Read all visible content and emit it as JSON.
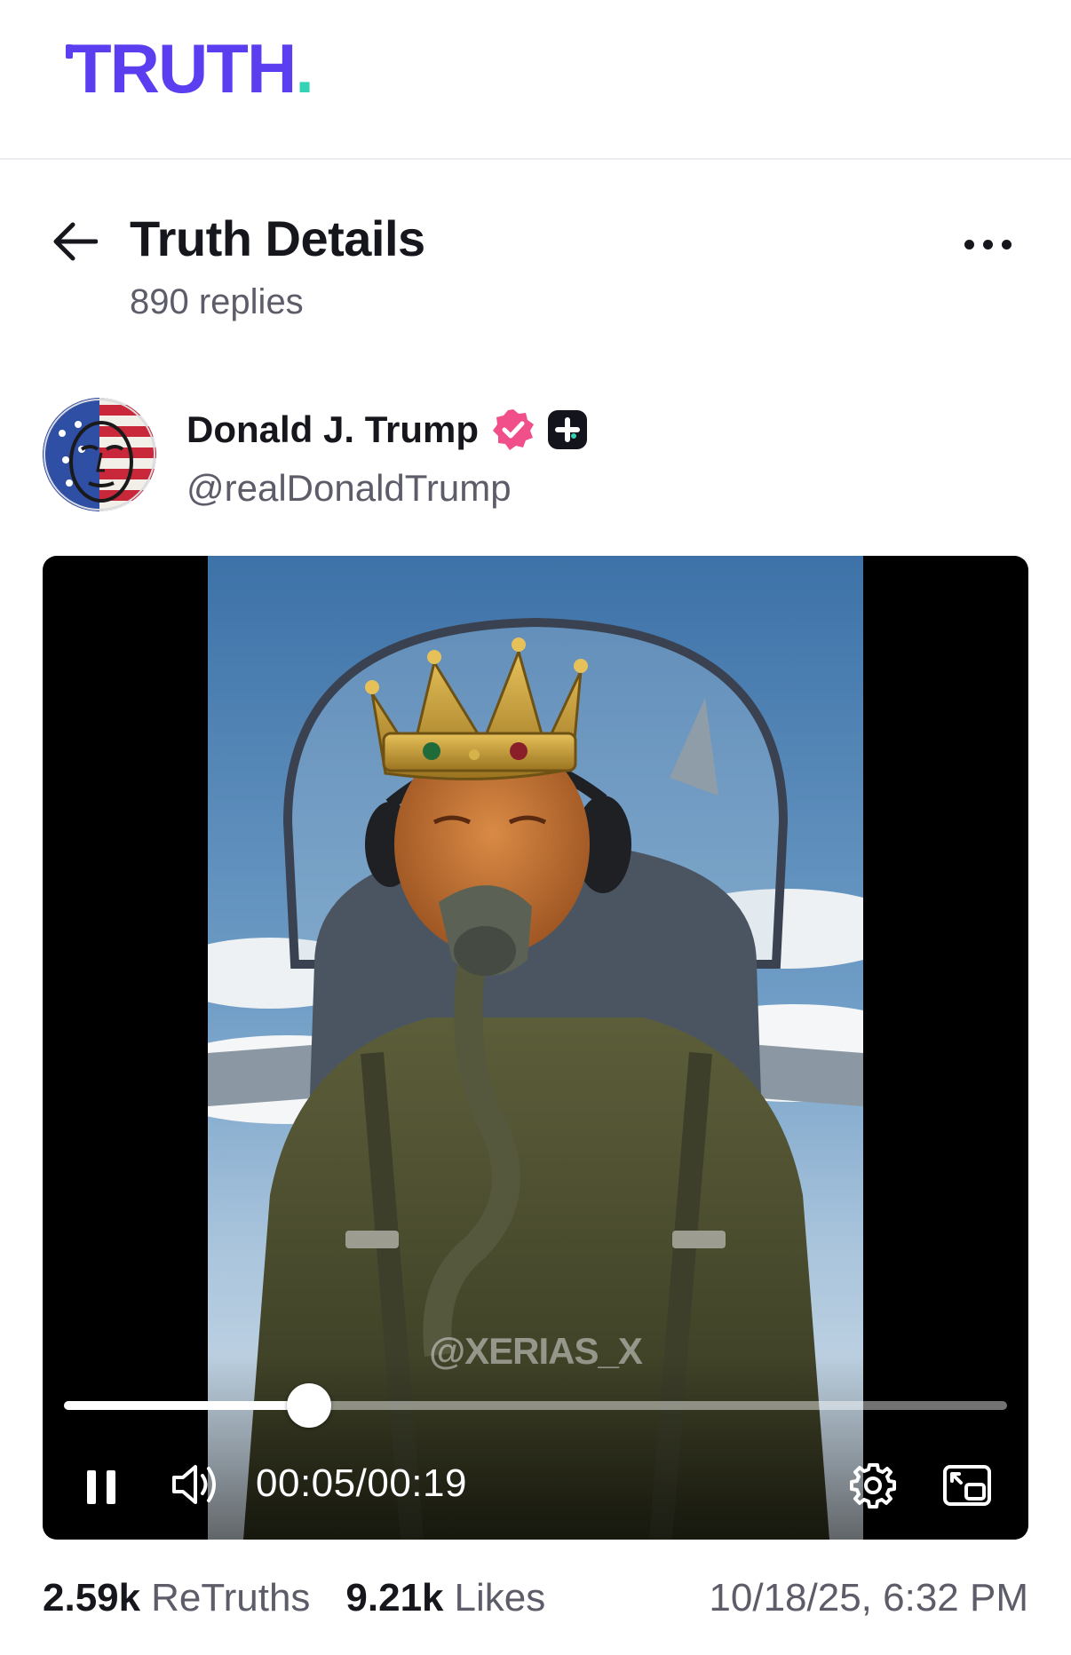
{
  "app": {
    "logo_text": "TRUTH",
    "logo_dot": ".",
    "colors": {
      "brand": "#5a3ef0",
      "accent": "#34d3b5",
      "verified": "#f14f8a"
    }
  },
  "header": {
    "title": "Truth Details",
    "replies": "890 replies",
    "back_icon": "arrow-left-icon",
    "more_icon": "more-horizontal-icon"
  },
  "author": {
    "name": "Donald J. Trump",
    "handle": "@realDonaldTrump",
    "verified_icon": "verified-badge-icon",
    "plus_icon": "truth-plus-icon"
  },
  "video": {
    "watermark": "@XERIAS_X",
    "current_time": "00:05",
    "separator": "/",
    "duration": "00:19",
    "progress_fraction": 0.26,
    "controls": [
      "pause-icon",
      "volume-icon",
      "settings-icon",
      "picture-in-picture-icon"
    ]
  },
  "stats": {
    "retruths_count": "2.59k",
    "retruths_label": "ReTruths",
    "likes_count": "9.21k",
    "likes_label": "Likes",
    "timestamp": "10/18/25, 6:32 PM"
  }
}
